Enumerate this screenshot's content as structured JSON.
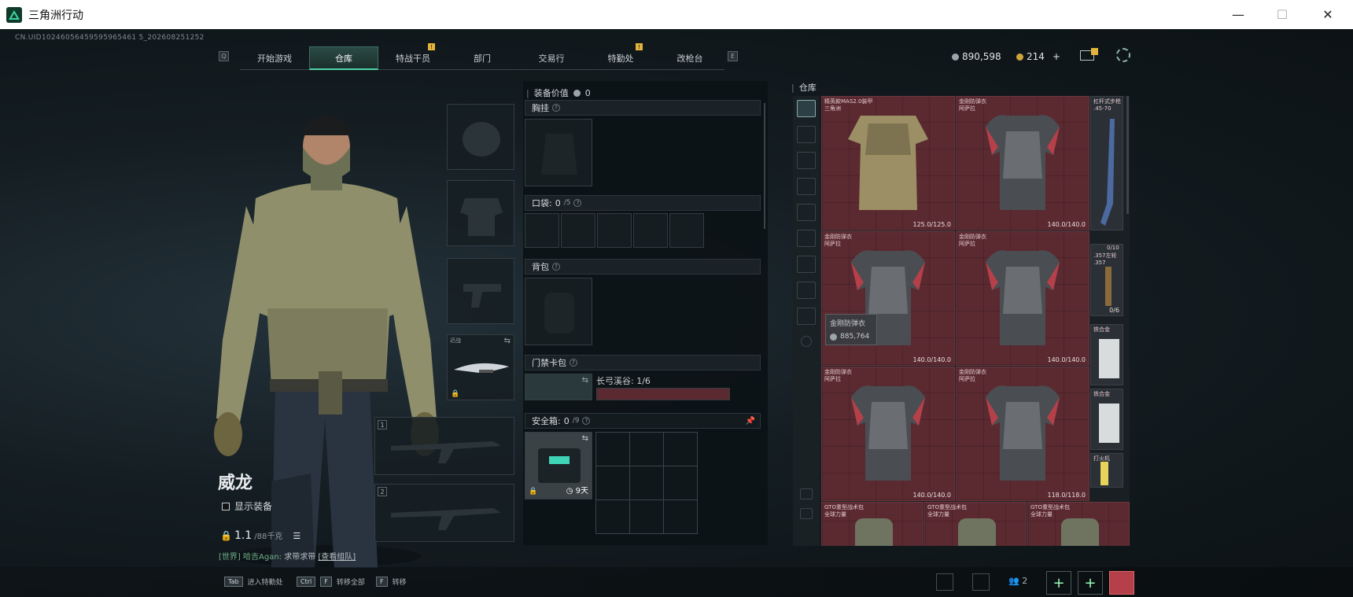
{
  "window": {
    "title": "三角洲行动",
    "minimize": "—",
    "maximize": "☐",
    "close": "✕"
  },
  "uid": "CN.UID10246056459595965461 5_202608251252",
  "nav": {
    "left_key": "Q",
    "right_key": "E",
    "tabs": [
      {
        "label": "开始游戏",
        "active": false,
        "badge": false
      },
      {
        "label": "仓库",
        "active": true,
        "badge": false
      },
      {
        "label": "特战干员",
        "active": false,
        "badge": true
      },
      {
        "label": "部门",
        "active": false,
        "badge": false
      },
      {
        "label": "交易行",
        "active": false,
        "badge": false
      },
      {
        "label": "特勤处",
        "active": false,
        "badge": true
      },
      {
        "label": "改枪台",
        "active": false,
        "badge": false
      }
    ],
    "badge_mark": "!"
  },
  "currency": {
    "coins": "890,598",
    "tickets": "214",
    "plus": "+"
  },
  "character": {
    "name": "威龙",
    "show_equip": "显示装备",
    "weight": "1.1",
    "weight_max": "/88千克"
  },
  "chat": {
    "channel": "[世界]",
    "user": "哈吉Agan:",
    "text": "求带求带",
    "link": "[查看组队]"
  },
  "slots": {
    "melee_label": "近战",
    "primary_num": "1",
    "secondary_num": "2"
  },
  "middle": {
    "equip_value_label": "装备价值",
    "equip_value": "0",
    "chest_rig": "胸挂",
    "pockets": "口袋:",
    "pockets_value": "0",
    "pockets_max": "/5",
    "backpack": "背包",
    "keycard": "门禁卡包",
    "keycard_item": "长弓溪谷: 1/6",
    "safebox": "安全箱:",
    "safebox_value": "0",
    "safebox_max": "/9",
    "safebox_days": "9天",
    "help": "?"
  },
  "warehouse": {
    "title": "仓库",
    "items": [
      {
        "name": "精英款MAS2.0装甲\n三角洲",
        "durability": "125.0/125.0",
        "color": "#5b2a31",
        "armor": "camo"
      },
      {
        "name": "金刚防弹衣\n阿萨拉",
        "durability": "140.0/140.0",
        "color": "#5b2a31",
        "armor": "steel"
      },
      {
        "name": "金刚防弹衣\n阿萨拉",
        "durability": "140.0/140.0",
        "color": "#5b2a31",
        "armor": "steel"
      },
      {
        "name": "金刚防弹衣\n阿萨拉",
        "durability": "140.0/140.0",
        "color": "#5b2a31",
        "armor": "steel"
      },
      {
        "name": "金刚防弹衣\n阿萨拉",
        "durability": "140.0/140.0",
        "color": "#5b2a31",
        "armor": "steel"
      },
      {
        "name": "金刚防弹衣\n阿萨拉",
        "durability": "118.0/118.0",
        "color": "#5b2a31",
        "armor": "steel"
      },
      {
        "name": "GTO重型战术包\n全球力量",
        "durability": "",
        "color": "#5b2a31",
        "armor": "bag"
      },
      {
        "name": "GTO重型战术包\n全球力量",
        "durability": "",
        "color": "#5b2a31",
        "armor": "bag"
      },
      {
        "name": "GTO重型战术包\n全球力量",
        "durability": "",
        "color": "#5b2a31",
        "armor": "bag"
      }
    ],
    "side_items": [
      {
        "name": "杠杆式步枪\n.45-70",
        "extra": "0/10"
      },
      {
        "name": ".357左轮\n.357",
        "extra": "0/6"
      },
      {
        "name": "铁合金",
        "extra": ""
      },
      {
        "name": "铁合金",
        "extra": ""
      },
      {
        "name": "打火机",
        "extra": ""
      }
    ],
    "tooltip_name": "金刚防弹衣",
    "tooltip_value": "885,764"
  },
  "bottom": {
    "keys": [
      {
        "key": "Tab",
        "label": "进入特勤处"
      },
      {
        "key": "Ctrl",
        "key2": "F",
        "label": "转移全部"
      },
      {
        "key": "F",
        "label": "转移"
      }
    ],
    "squad_count": "2",
    "plus1": "+",
    "plus2": "+"
  }
}
